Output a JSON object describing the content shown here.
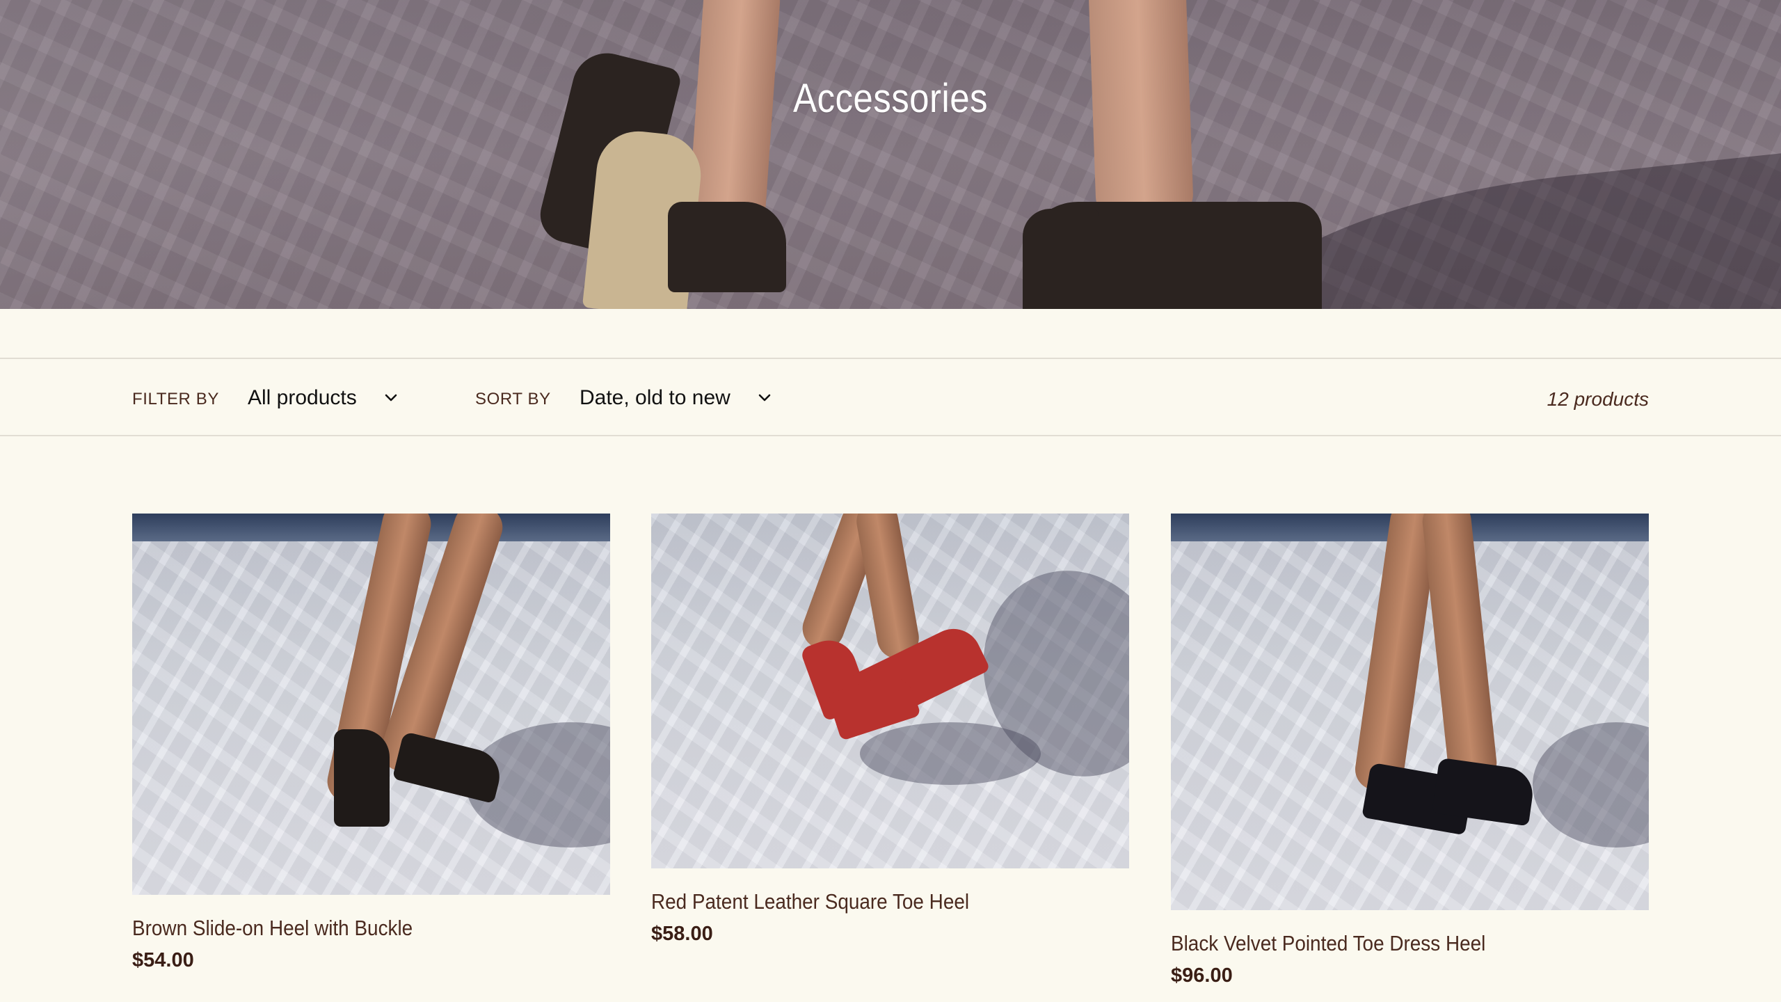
{
  "hero": {
    "title": "Accessories"
  },
  "filters": {
    "filter_label": "FILTER BY",
    "filter_value": "All products",
    "sort_label": "SORT BY",
    "sort_value": "Date, old to new",
    "product_count": "12 products"
  },
  "products": [
    {
      "name": "Brown Slide-on Heel with Buckle",
      "price": "$54.00",
      "shoe_color": "#1f1a18"
    },
    {
      "name": "Red Patent Leather Square Toe Heel",
      "price": "$58.00",
      "shoe_color": "#b8322e"
    },
    {
      "name": "Black Velvet Pointed Toe Dress Heel",
      "price": "$96.00",
      "shoe_color": "#15141a"
    }
  ],
  "colors": {
    "background": "#fbf9ef",
    "text_brown": "#4a2a1f",
    "divider": "#e1ddd3"
  }
}
